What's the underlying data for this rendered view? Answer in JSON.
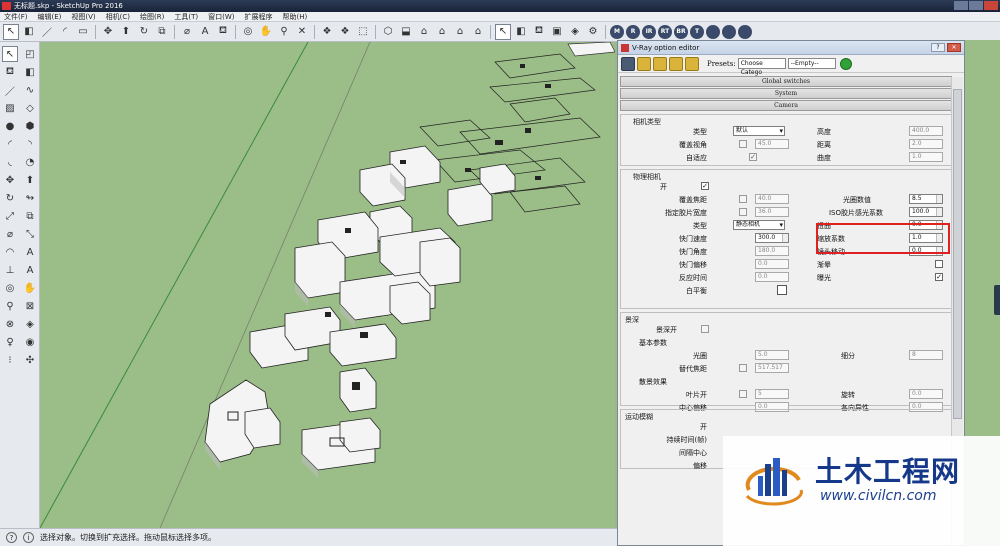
{
  "window": {
    "title": "无标题.skp - SketchUp Pro 2016"
  },
  "menu": [
    "文件(F)",
    "编辑(E)",
    "视图(V)",
    "相机(C)",
    "绘图(R)",
    "工具(T)",
    "窗口(W)",
    "扩展程序",
    "帮助(H)"
  ],
  "toolbar": {
    "round_buttons": [
      "M",
      "R",
      "IR",
      "RT",
      "BR",
      "T",
      "",
      "",
      ""
    ]
  },
  "statusbar": {
    "text": "选择对象。切换到扩充选择。拖动鼠标选择多项。"
  },
  "vray": {
    "title": "V-Ray option editor",
    "presets_label": "Presets:",
    "preset_category": "Choose Catego",
    "preset_value": "--Empty--",
    "rollouts_top": [
      "Global switches",
      "System",
      "Camera"
    ],
    "camera_type": {
      "group_title": "相机类型",
      "type_label": "类型",
      "type_value": "默认",
      "fov_override_label": "覆盖视角",
      "fov_value": "45.0",
      "auto_fit_label": "自适应",
      "auto_fit_checked": "✓",
      "height_label": "高度",
      "height_value": "400.0",
      "distance_label": "距离",
      "distance_value": "2.0",
      "curve_label": "曲度",
      "curve_value": "1.0"
    },
    "physical": {
      "group_title": "物理相机",
      "on_label": "开",
      "on_checked": "✓",
      "focus_override_label": "覆盖焦距",
      "focus_value": "40.0",
      "film_override_label": "指定胶片宽度",
      "film_value": "36.0",
      "type_label": "类型",
      "type_value": "静态相机",
      "shutter_speed_label": "快门速度",
      "shutter_speed_value": "300.0",
      "shutter_angle_label": "快门角度",
      "shutter_angle_value": "180.0",
      "shutter_offset_label": "快门偏移",
      "shutter_offset_value": "0.0",
      "latency_label": "反应时间",
      "latency_value": "0.0",
      "white_balance_label": "白平衡",
      "f_number_label": "光圈数值",
      "f_number_value": "8.5",
      "iso_label": "ISO胶片感光系数",
      "iso_value": "100.0",
      "distortion_label": "扭曲",
      "distortion_value": "0.0",
      "zoom_label": "缩放系数",
      "zoom_value": "1.0",
      "lens_shift_label": "镜头移动",
      "lens_shift_value": "0.0",
      "vignetting_label": "渐晕",
      "vignetting_checked": "",
      "exposure_label": "曝光",
      "exposure_checked": "✓"
    },
    "dof": {
      "group_title": "景深",
      "on_label": "景深开",
      "basic_title": "基本参数",
      "aperture_label": "光圈",
      "aperture_value": "5.0",
      "subdivs_label": "细分",
      "subdivs_value": "8",
      "focal_override_label": "替代焦距",
      "focal_value": "517.517",
      "bokeh_title": "散景效果",
      "blades_label": "叶片开",
      "blades_value": "5",
      "rotation_label": "旋转",
      "rotation_value": "0.0",
      "center_bias_label": "中心偏移",
      "center_bias_value": "0.0",
      "anisotropy_label": "各向异性",
      "anisotropy_value": "0.0"
    },
    "motion_blur": {
      "group_title": "运动模糊",
      "on_label": "开",
      "duration_label": "持续时间(帧)",
      "interval_center_label": "间隔中心",
      "bias_label": "偏移"
    }
  },
  "watermark": {
    "cn": "土木工程网",
    "url": "www.civilcn.com"
  },
  "colors": {
    "viewport_bg": "#9bbd87",
    "highlight": "#e02020",
    "wm_blue": "#15388a"
  }
}
